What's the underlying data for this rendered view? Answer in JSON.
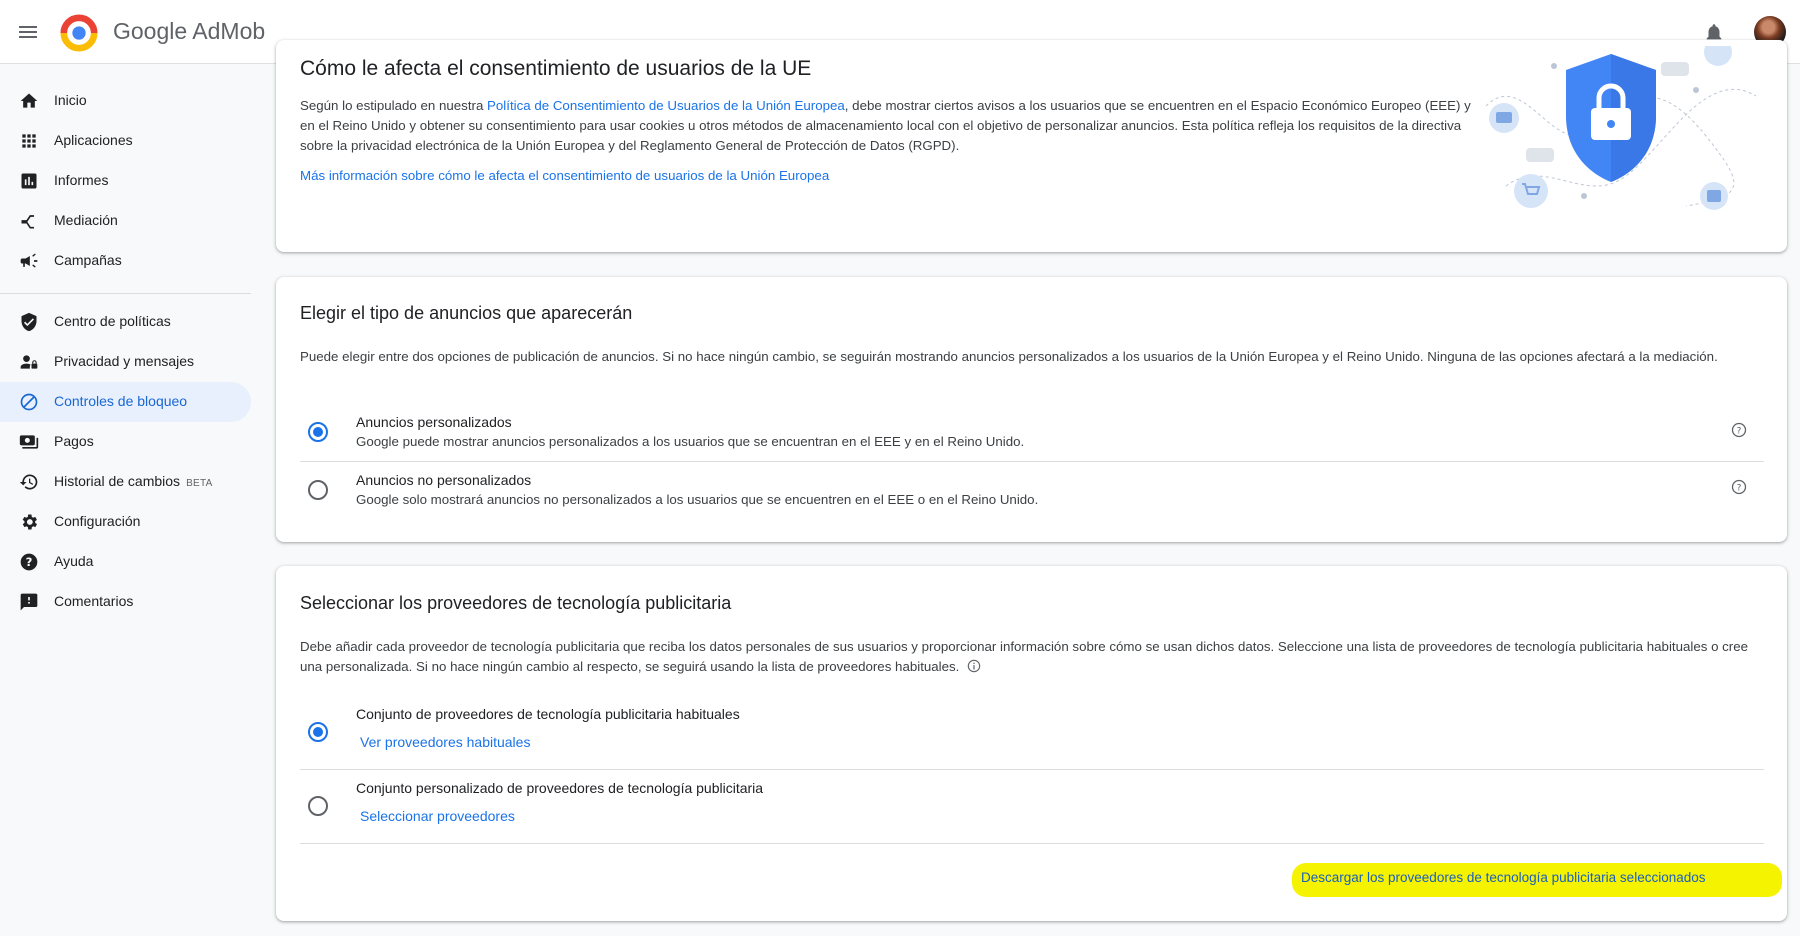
{
  "app": {
    "brand_prefix": "Google",
    "brand_name": "AdMob"
  },
  "sidebar": {
    "items": [
      {
        "label": "Inicio",
        "icon": "home-icon"
      },
      {
        "label": "Aplicaciones",
        "icon": "apps-grid-icon"
      },
      {
        "label": "Informes",
        "icon": "bar-chart-icon"
      },
      {
        "label": "Mediación",
        "icon": "mediation-icon"
      },
      {
        "label": "Campañas",
        "icon": "megaphone-icon"
      },
      {
        "label": "Centro de políticas",
        "icon": "shield-check-icon"
      },
      {
        "label": "Privacidad y mensajes",
        "icon": "person-privacy-icon"
      },
      {
        "label": "Controles de bloqueo",
        "icon": "block-icon",
        "active": true
      },
      {
        "label": "Pagos",
        "icon": "payments-icon"
      },
      {
        "label": "Historial de cambios",
        "icon": "history-icon",
        "badge": "BETA"
      },
      {
        "label": "Configuración",
        "icon": "gear-icon"
      },
      {
        "label": "Ayuda",
        "icon": "help-icon"
      },
      {
        "label": "Comentarios",
        "icon": "feedback-icon"
      }
    ]
  },
  "consent_card": {
    "title": "Cómo le afecta el consentimiento de usuarios de la UE",
    "para_before_link": "Según lo estipulado en nuestra ",
    "policy_link": "Política de Consentimiento de Usuarios de la Unión Europea",
    "para_after_link": ", debe mostrar ciertos avisos a los usuarios que se encuentren en el Espacio Económico Europeo (EEE) y en el Reino Unido y obtener su consentimiento para usar cookies u otros métodos de almacenamiento local con el objetivo de personalizar anuncios. Esta política refleja los requisitos de la directiva sobre la privacidad electrónica de la Unión Europea y del Reglamento General de Protección de Datos (RGPD).",
    "more_info_link": "Más información sobre cómo le afecta el consentimiento de usuarios de la Unión Europea"
  },
  "ads_card": {
    "title": "Elegir el tipo de anuncios que aparecerán",
    "description": "Puede elegir entre dos opciones de publicación de anuncios. Si no hace ningún cambio, se seguirán mostrando anuncios personalizados a los usuarios de la Unión Europea y el Reino Unido. Ninguna de las opciones afectará a la mediación.",
    "options": [
      {
        "title": "Anuncios personalizados",
        "desc": "Google puede mostrar anuncios personalizados a los usuarios que se encuentran en el EEE y en el Reino Unido.",
        "selected": true
      },
      {
        "title": "Anuncios no personalizados",
        "desc": "Google solo mostrará anuncios no personalizados a los usuarios que se encuentren en el EEE o en el Reino Unido.",
        "selected": false
      }
    ]
  },
  "providers_card": {
    "title": "Seleccionar los proveedores de tecnología publicitaria",
    "description": "Debe añadir cada proveedor de tecnología publicitaria que reciba los datos personales de sus usuarios y proporcionar información sobre cómo se usan dichos datos. Seleccione una lista de proveedores de tecnología publicitaria habituales o cree una personalizada. Si no hace ningún cambio al respecto, se seguirá usando la lista de proveedores habituales.",
    "options": [
      {
        "title": "Conjunto de proveedores de tecnología publicitaria habituales",
        "link": "Ver proveedores habituales",
        "selected": true
      },
      {
        "title": "Conjunto personalizado de proveedores de tecnología publicitaria",
        "link": "Seleccionar proveedores",
        "selected": false
      }
    ],
    "download_link": "Descargar los proveedores de tecnología publicitaria seleccionados"
  },
  "colors": {
    "accent": "#1a73e8",
    "highlight": "#f6f300",
    "active_nav_bg": "#e8f0fe"
  }
}
